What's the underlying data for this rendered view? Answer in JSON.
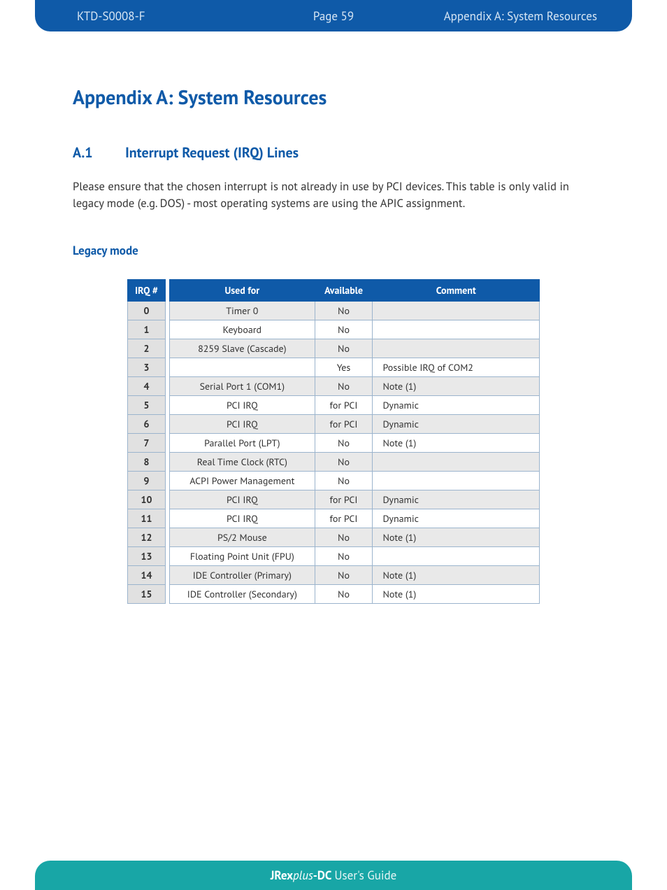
{
  "header": {
    "doc_id": "KTD-S0008-F",
    "page": "Page 59",
    "section": "Appendix A: System Resources"
  },
  "content": {
    "h1": "Appendix A: System Resources",
    "h2_num": "A.1",
    "h2_title": "Interrupt Request (IRQ) Lines",
    "intro": "Please ensure that the chosen interrupt is not already in use by PCI devices. This table is only valid in legacy mode (e.g. DOS) - most operating systems are using the APIC assignment.",
    "h3": "Legacy mode"
  },
  "table": {
    "headers": {
      "irq": "IRQ #",
      "used": "Used for",
      "avail": "Available",
      "comment": "Comment"
    },
    "rows": [
      {
        "irq": "0",
        "used": "Timer 0",
        "avail": "No",
        "comment": ""
      },
      {
        "irq": "1",
        "used": "Keyboard",
        "avail": "No",
        "comment": ""
      },
      {
        "irq": "2",
        "used": "8259 Slave (Cascade)",
        "avail": "No",
        "comment": ""
      },
      {
        "irq": "3",
        "used": "",
        "avail": "Yes",
        "comment": "Possible IRQ of COM2"
      },
      {
        "irq": "4",
        "used": "Serial Port 1 (COM1)",
        "avail": "No",
        "comment": "Note (1)"
      },
      {
        "irq": "5",
        "used": "PCI IRQ",
        "avail": "for PCI",
        "comment": "Dynamic"
      },
      {
        "irq": "6",
        "used": "PCI IRQ",
        "avail": "for PCI",
        "comment": "Dynamic"
      },
      {
        "irq": "7",
        "used": "Parallel Port (LPT)",
        "avail": "No",
        "comment": "Note (1)"
      },
      {
        "irq": "8",
        "used": "Real Time Clock (RTC)",
        "avail": "No",
        "comment": ""
      },
      {
        "irq": "9",
        "used": "ACPI Power Management",
        "avail": "No",
        "comment": ""
      },
      {
        "irq": "10",
        "used": "PCI IRQ",
        "avail": "for PCI",
        "comment": "Dynamic"
      },
      {
        "irq": "11",
        "used": "PCI IRQ",
        "avail": "for PCI",
        "comment": "Dynamic"
      },
      {
        "irq": "12",
        "used": "PS/2 Mouse",
        "avail": "No",
        "comment": "Note (1)"
      },
      {
        "irq": "13",
        "used": "Floating Point Unit (FPU)",
        "avail": "No",
        "comment": ""
      },
      {
        "irq": "14",
        "used": "IDE Controller (Primary)",
        "avail": "No",
        "comment": "Note (1)"
      },
      {
        "irq": "15",
        "used": "IDE Controller (Secondary)",
        "avail": "No",
        "comment": "Note (1)"
      }
    ]
  },
  "footer": {
    "p1": "JRex",
    "p2": "plus",
    "p3": "-DC",
    "p4": "User's Guide"
  }
}
